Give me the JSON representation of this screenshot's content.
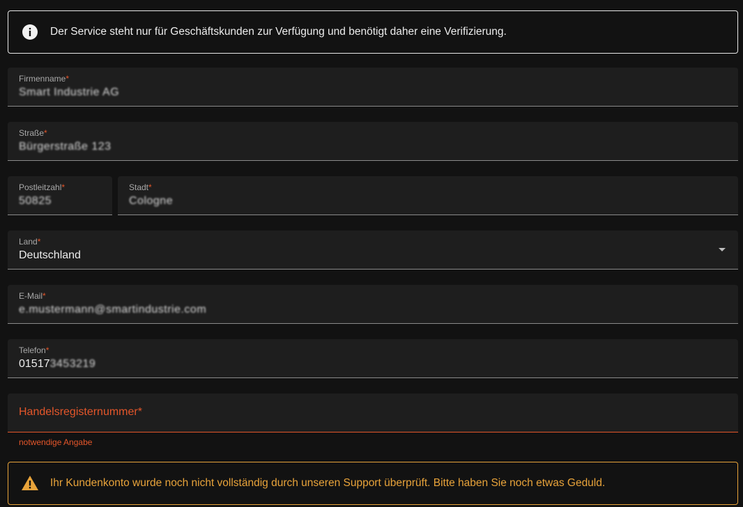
{
  "info_alert": {
    "icon": "info-icon",
    "text": "Der Service steht nur für Geschäftskunden zur Verfügung und benötigt daher eine Verifizierung."
  },
  "form": {
    "company": {
      "label": "Firmenname",
      "required_mark": "*",
      "value": "Smart Industrie AG"
    },
    "street": {
      "label": "Straße",
      "required_mark": "*",
      "value": "Bürgerstraße 123"
    },
    "zip": {
      "label": "Postleitzahl",
      "required_mark": "*",
      "value": "50825"
    },
    "city": {
      "label": "Stadt",
      "required_mark": "*",
      "value": "Cologne"
    },
    "country": {
      "label": "Land",
      "required_mark": "*",
      "value": "Deutschland",
      "icon": "arrow-drop-down-icon"
    },
    "email": {
      "label": "E-Mail",
      "required_mark": "*",
      "value": "e.mustermann@smartindustrie.com"
    },
    "phone": {
      "label": "Telefon",
      "required_mark": "*",
      "value_visible": "01517",
      "value_hidden": "3453219"
    },
    "register": {
      "label": "Handelsregisternummer*",
      "helper": "notwendige Angabe",
      "value": ""
    }
  },
  "warning_alert": {
    "icon": "warning-icon",
    "text": "Ihr Kundenkonto wurde noch nicht vollständig durch unseren Support überprüft. Bitte haben Sie noch etwas Geduld."
  },
  "colors": {
    "background": "#121212",
    "field_bg": "#1e1e1e",
    "error": "#e4562a",
    "warning": "#e8a33a"
  }
}
